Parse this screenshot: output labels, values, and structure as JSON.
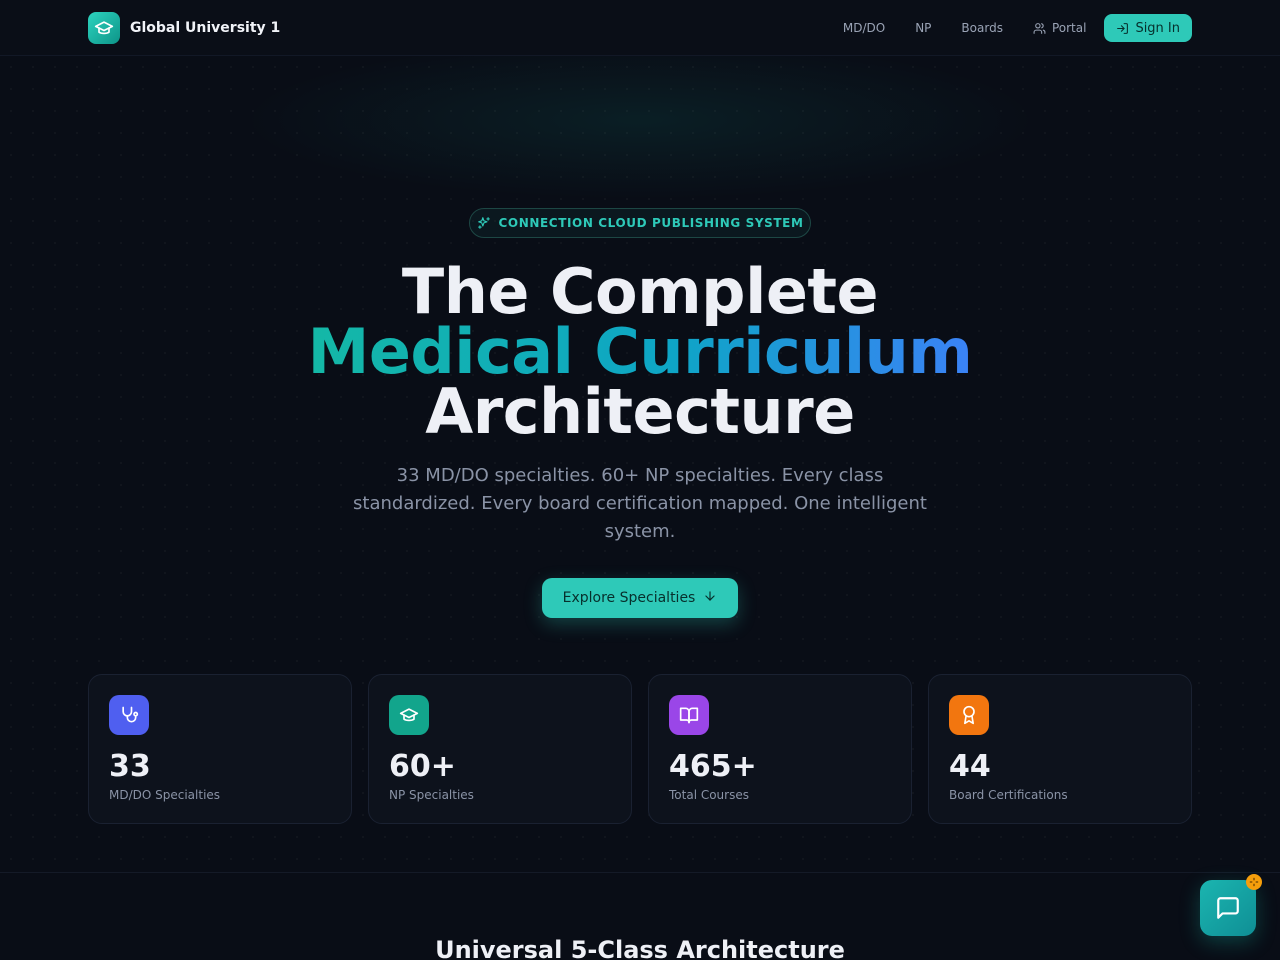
{
  "brand": {
    "name": "Global University 1",
    "logo_icon": "graduation-cap-icon"
  },
  "nav": {
    "links": [
      "MD/DO",
      "NP",
      "Boards"
    ],
    "portal_label": "Portal",
    "signin_label": "Sign In"
  },
  "hero": {
    "badge": "CONNECTION CLOUD PUBLISHING SYSTEM",
    "title_line1": "The Complete",
    "title_line2": "Medical Curriculum",
    "title_line3": "Architecture",
    "subtitle": "33 MD/DO specialties. 60+ NP specialties. Every class standardized. Every board certification mapped. One intelligent system.",
    "cta_label": "Explore Specialties"
  },
  "stats": [
    {
      "value": "33",
      "label": "MD/DO Specialties",
      "icon": "stethoscope-icon",
      "color": "#4f5ff0"
    },
    {
      "value": "60+",
      "label": "NP Specialties",
      "icon": "graduation-cap-icon",
      "color": "#12a58c"
    },
    {
      "value": "465+",
      "label": "Total Courses",
      "icon": "book-open-icon",
      "color": "#9a46e8"
    },
    {
      "value": "44",
      "label": "Board Certifications",
      "icon": "award-icon",
      "color": "#f2760f"
    }
  ],
  "section": {
    "title": "Universal 5-Class Architecture"
  },
  "colors": {
    "accent": "#2ec9b8",
    "background": "#090d16"
  }
}
